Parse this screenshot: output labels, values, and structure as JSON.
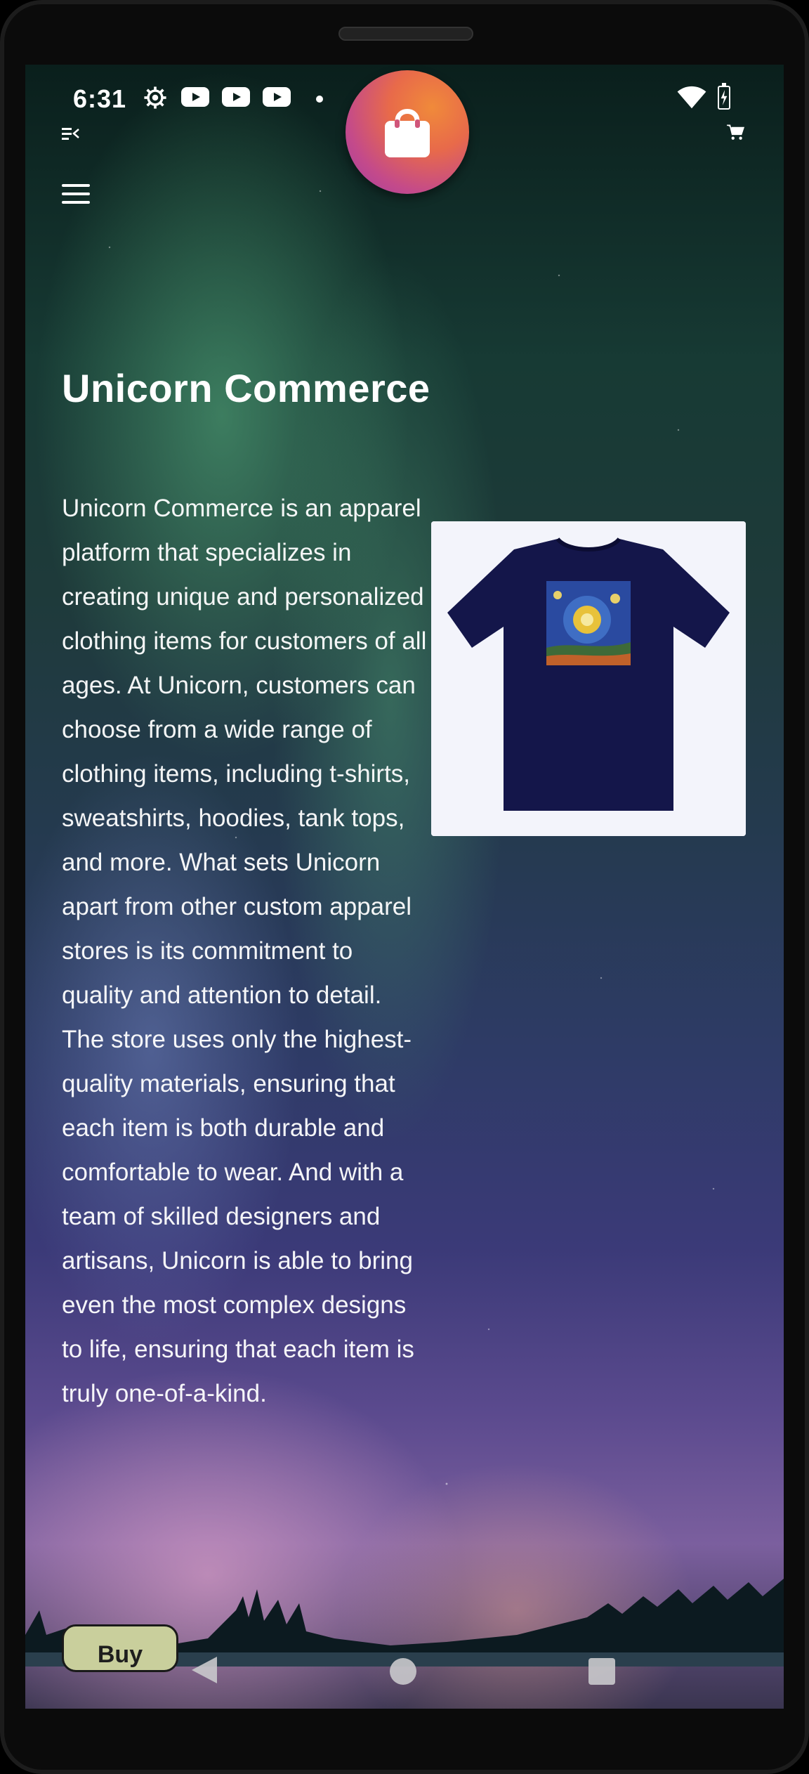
{
  "status_bar": {
    "time": "6:31",
    "icons": [
      "settings-gear-icon",
      "youtube-icon",
      "youtube-icon",
      "youtube-icon",
      "notification-dot-icon",
      "wifi-icon",
      "battery-charging-icon"
    ]
  },
  "app": {
    "logo_icon": "shopping-bag-icon",
    "menu_icon": "hamburger-menu-icon"
  },
  "main": {
    "title": "Unicorn Commerce",
    "description": "Unicorn Commerce is an apparel platform that specializes in creating unique and personalized clothing items for customers of all ages. At Unicorn, customers can choose from a wide range of clothing items, including t-shirts, sweatshirts, hoodies, tank tops, and more. What sets Unicorn apart from other custom apparel stores is its commitment to quality and attention to detail. The store uses only the highest-quality materials, ensuring that each item is both durable and comfortable to wear. And with a team of skilled designers and artisans, Unicorn is able to bring even the most complex designs to life, ensuring that each item is truly one-of-a-kind.",
    "product_image": "navy-t-shirt-starry-night-print",
    "buy_button": "Buy"
  },
  "nav_bar": {
    "icons": [
      "back-icon",
      "home-icon",
      "recents-icon"
    ]
  },
  "colors": {
    "logo_gradient_start": "#f08a3a",
    "logo_gradient_end": "#a03ea6",
    "buy_button_bg": "#c9cf9c",
    "shirt": "#14164a"
  }
}
